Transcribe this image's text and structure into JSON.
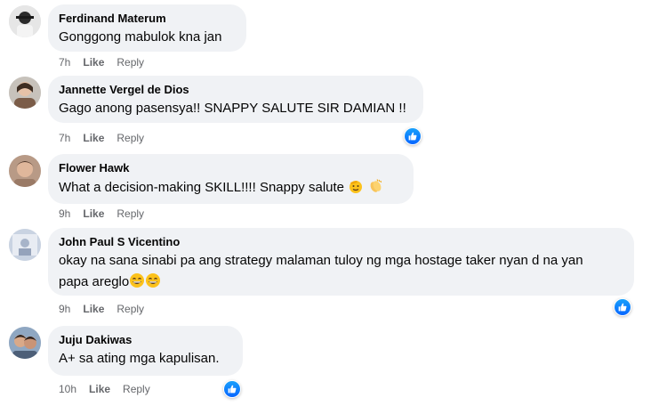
{
  "colors": {
    "bubble": "#f0f2f5",
    "meta": "#65676b",
    "like_badge": "#0866ff"
  },
  "comments": [
    {
      "author": "Ferdinand Materum",
      "text": "Gonggong mabulok kna jan",
      "time": "7h",
      "like": "Like",
      "reply": "Reply",
      "has_reaction": false
    },
    {
      "author": "Jannette Vergel de Dios",
      "text": "Gago anong pasensya!! SNAPPY SALUTE SIR DAMIAN !!",
      "time": "7h",
      "like": "Like",
      "reply": "Reply",
      "has_reaction": true,
      "reaction_icon": "like-reaction-icon"
    },
    {
      "author": "Flower Hawk",
      "text": "What a decision-making SKILL!!!! Snappy salute",
      "emojis": [
        "saluting-face-emoji",
        "clapping-hands-emoji"
      ],
      "time": "9h",
      "like": "Like",
      "reply": "Reply",
      "has_reaction": false
    },
    {
      "author": "John Paul S Vicentino",
      "text_line1": "okay na sana sinabi pa ang strategy malaman tuloy ng mga hostage taker nyan d na yan",
      "text_line2": "papa areglo",
      "emojis": [
        "grinning-smiling-eyes-emoji",
        "grinning-smiling-eyes-emoji"
      ],
      "time": "9h",
      "like": "Like",
      "reply": "Reply",
      "has_reaction": true,
      "reaction_icon": "like-reaction-icon"
    },
    {
      "author": "Juju Dakiwas",
      "text": "A+ sa ating mga kapulisan.",
      "time": "10h",
      "like": "Like",
      "reply": "Reply",
      "has_reaction": true,
      "reaction_icon": "like-reaction-icon"
    }
  ]
}
